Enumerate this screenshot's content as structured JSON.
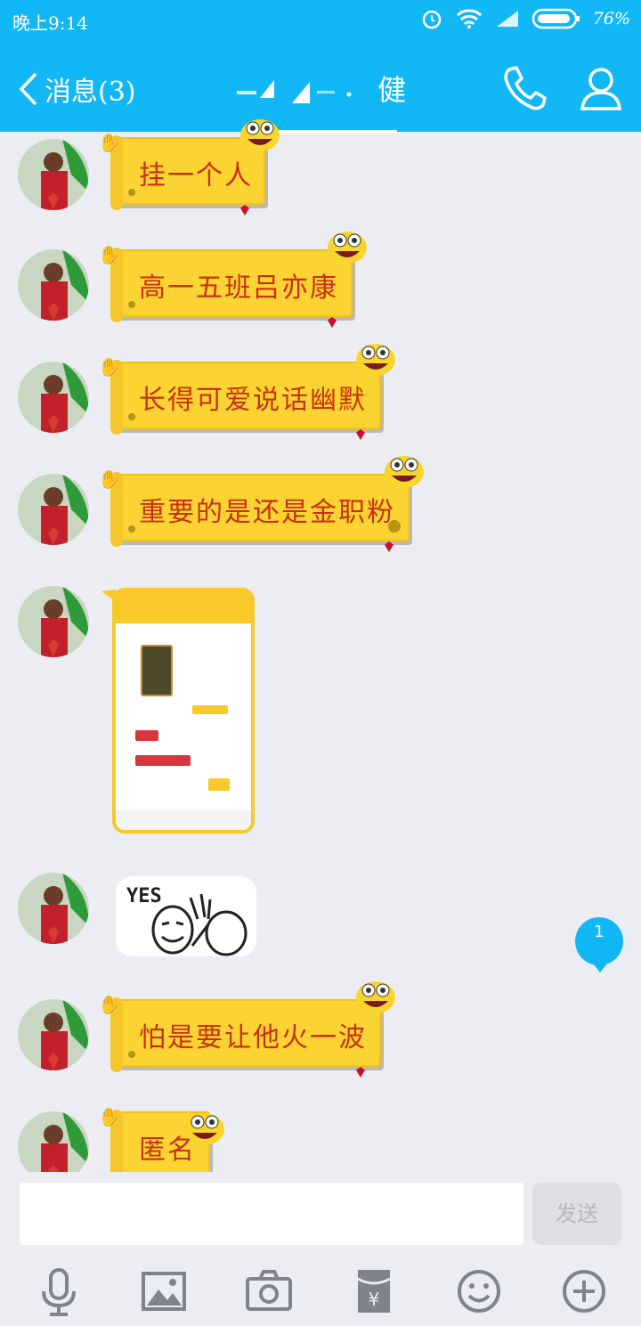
{
  "status_bar": {
    "time": "晚上9:14",
    "battery": "76%"
  },
  "nav": {
    "back_label": "消息(3)",
    "title": "健"
  },
  "messages": [
    {
      "text": "挂一个人"
    },
    {
      "text": "高一五班吕亦康"
    },
    {
      "text": "长得可爱说话幽默"
    },
    {
      "text": "重要的是还是金职粉"
    },
    {
      "text": "怕是要让他火一波"
    },
    {
      "text": "匿名"
    }
  ],
  "sticker": {
    "caption": "YES"
  },
  "unread_badge": "1",
  "input": {
    "placeholder": "",
    "send_label": "发送"
  },
  "toolbar": {
    "items": [
      "microphone-icon",
      "image-icon",
      "camera-icon",
      "red-packet-icon",
      "emoji-icon",
      "plus-icon"
    ]
  },
  "colors": {
    "brand": "#12b7f5",
    "bubble": "#fbd433",
    "bubble_text": "#c8310f",
    "background": "#ebedf3"
  }
}
